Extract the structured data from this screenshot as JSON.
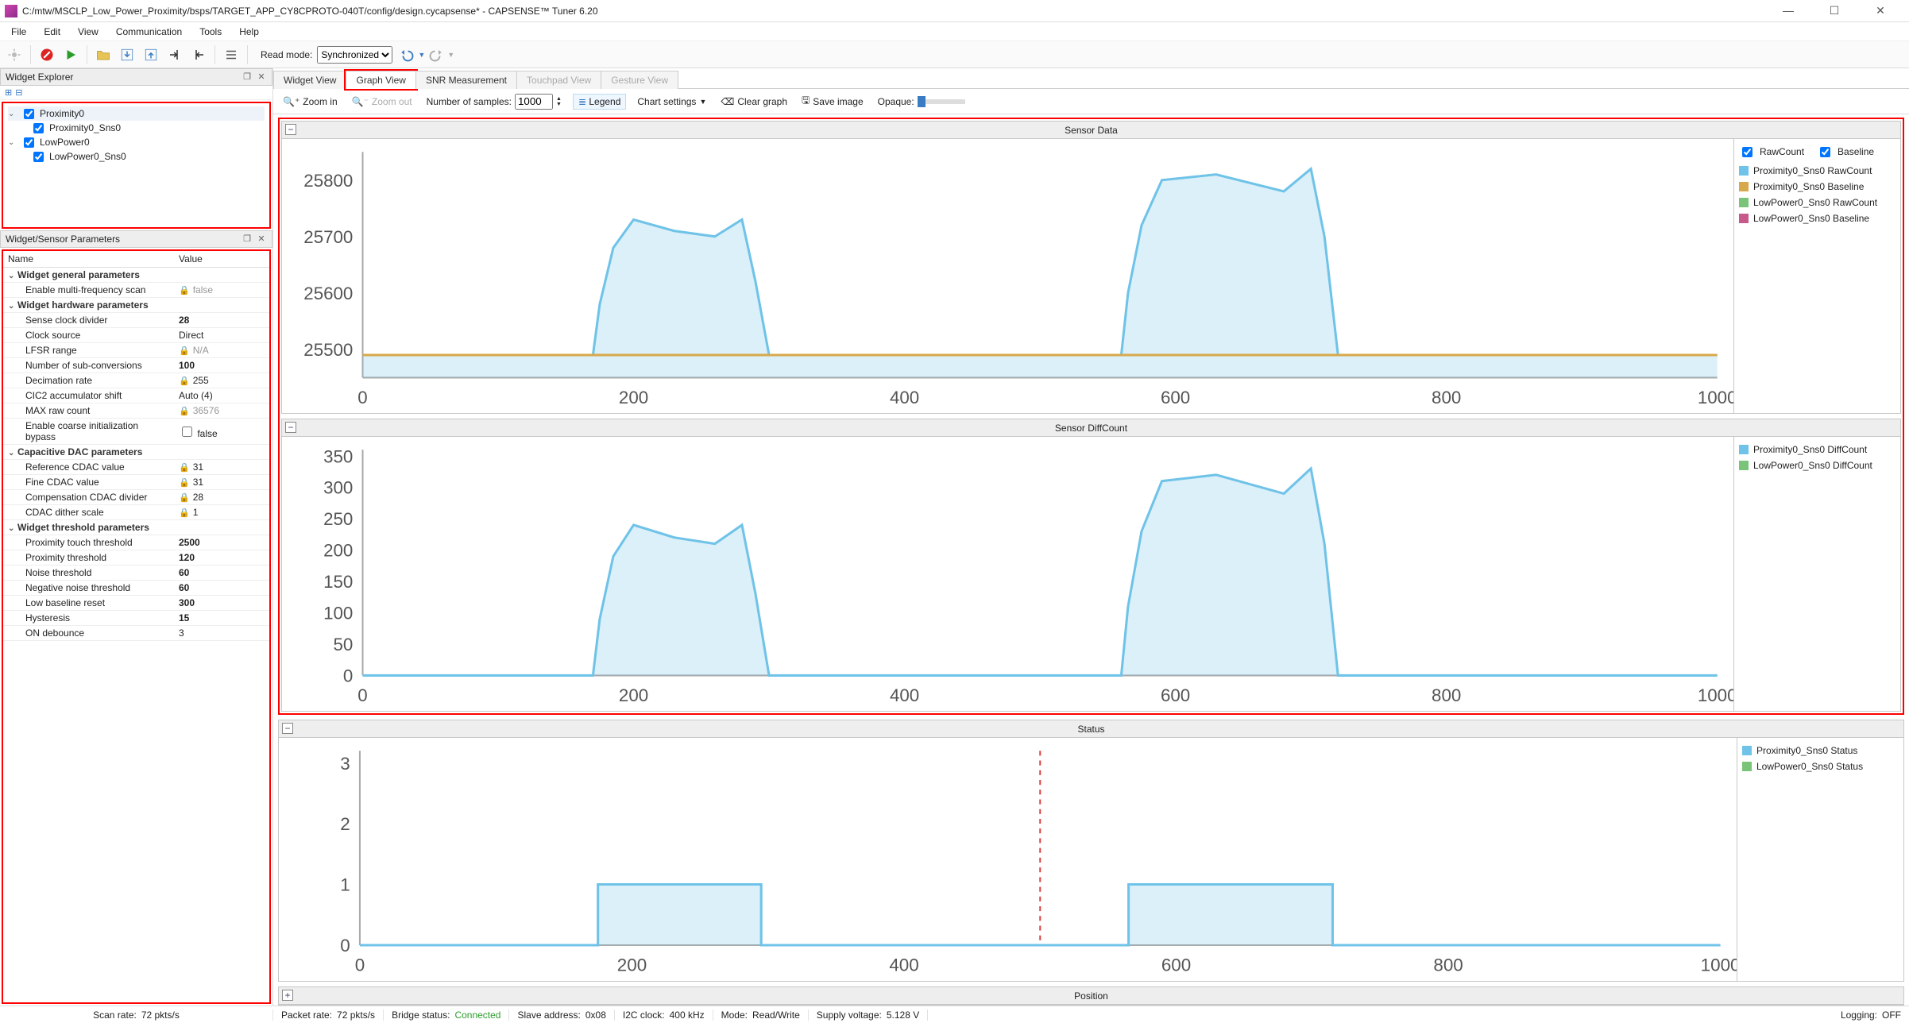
{
  "title": "C:/mtw/MSCLP_Low_Power_Proximity/bsps/TARGET_APP_CY8CPROTO-040T/config/design.cycapsense* - CAPSENSE™ Tuner 6.20",
  "menu": [
    "File",
    "Edit",
    "View",
    "Communication",
    "Tools",
    "Help"
  ],
  "toolbar": {
    "readmode_label": "Read mode:",
    "readmode_value": "Synchronized"
  },
  "explorer": {
    "title": "Widget Explorer",
    "items": [
      {
        "label": "Proximity0",
        "children": [
          {
            "label": "Proximity0_Sns0"
          }
        ]
      },
      {
        "label": "LowPower0",
        "children": [
          {
            "label": "LowPower0_Sns0"
          }
        ]
      }
    ]
  },
  "params": {
    "title": "Widget/Sensor Parameters",
    "columns": [
      "Name",
      "Value"
    ],
    "groups": [
      {
        "name": "Widget general parameters",
        "rows": [
          {
            "n": "Enable multi-frequency scan",
            "v": "false",
            "lock": true,
            "gray": true
          }
        ]
      },
      {
        "name": "Widget hardware parameters",
        "rows": [
          {
            "n": "Sense clock divider",
            "v": "28",
            "bold": true
          },
          {
            "n": "Clock source",
            "v": "Direct"
          },
          {
            "n": "LFSR range",
            "v": "N/A",
            "lock": true,
            "gray": true
          },
          {
            "n": "Number of sub-conversions",
            "v": "100",
            "bold": true
          },
          {
            "n": "Decimation rate",
            "v": "255",
            "lock": true
          },
          {
            "n": "CIC2 accumulator shift",
            "v": "Auto (4)"
          },
          {
            "n": "MAX raw count",
            "v": "36576",
            "lock": true,
            "gray": true
          },
          {
            "n": "Enable coarse initialization bypass",
            "v": "false",
            "checkbox": true
          }
        ]
      },
      {
        "name": "Capacitive DAC parameters",
        "rows": [
          {
            "n": "Reference CDAC value",
            "v": "31",
            "lock": true
          },
          {
            "n": "Fine CDAC value",
            "v": "31",
            "lock": true
          },
          {
            "n": "Compensation CDAC divider",
            "v": "28",
            "lock": true
          },
          {
            "n": "CDAC dither scale",
            "v": "1",
            "lock": true
          }
        ]
      },
      {
        "name": "Widget threshold parameters",
        "rows": [
          {
            "n": "Proximity touch threshold",
            "v": "2500",
            "bold": true
          },
          {
            "n": "Proximity threshold",
            "v": "120",
            "bold": true
          },
          {
            "n": "Noise threshold",
            "v": "60",
            "bold": true
          },
          {
            "n": "Negative noise threshold",
            "v": "60",
            "bold": true
          },
          {
            "n": "Low baseline reset",
            "v": "300",
            "bold": true
          },
          {
            "n": "Hysteresis",
            "v": "15",
            "bold": true
          },
          {
            "n": "ON debounce",
            "v": "3"
          }
        ]
      }
    ]
  },
  "tabs": [
    "Widget View",
    "Graph View",
    "SNR Measurement",
    "Touchpad View",
    "Gesture View"
  ],
  "gtoolbar": {
    "zoom_in": "Zoom in",
    "zoom_out": "Zoom out",
    "num_label": "Number of samples:",
    "num_value": "1000",
    "legend": "Legend",
    "chart_settings": "Chart settings",
    "clear": "Clear graph",
    "save": "Save image",
    "opaque": "Opaque:"
  },
  "charts": {
    "sensor_data": {
      "title": "Sensor Data",
      "legend_top": [
        "RawCount",
        "Baseline"
      ],
      "series": [
        {
          "name": "Proximity0_Sns0 RawCount",
          "color": "#6fc3e8"
        },
        {
          "name": "Proximity0_Sns0 Baseline",
          "color": "#d8a94b"
        },
        {
          "name": "LowPower0_Sns0 RawCount",
          "color": "#7ac47a"
        },
        {
          "name": "LowPower0_Sns0 Baseline",
          "color": "#c75a8a"
        }
      ]
    },
    "diff": {
      "title": "Sensor DiffCount",
      "series": [
        {
          "name": "Proximity0_Sns0 DiffCount",
          "color": "#6fc3e8"
        },
        {
          "name": "LowPower0_Sns0 DiffCount",
          "color": "#7ac47a"
        }
      ]
    },
    "status": {
      "title": "Status",
      "series": [
        {
          "name": "Proximity0_Sns0 Status",
          "color": "#6fc3e8"
        },
        {
          "name": "LowPower0_Sns0 Status",
          "color": "#7ac47a"
        }
      ]
    },
    "position": {
      "title": "Position"
    }
  },
  "chart_data": [
    {
      "type": "line",
      "title": "Sensor Data",
      "xlabel": "",
      "ylabel": "",
      "xlim": [
        0,
        1000
      ],
      "ylim": [
        25450,
        25850
      ],
      "xticks": [
        0,
        200,
        400,
        600,
        800,
        1000
      ],
      "yticks": [
        25500,
        25600,
        25700,
        25800
      ],
      "series": [
        {
          "name": "Proximity0_Sns0 RawCount",
          "x": [
            0,
            170,
            175,
            185,
            200,
            230,
            260,
            280,
            290,
            300,
            560,
            565,
            575,
            590,
            630,
            680,
            700,
            710,
            720,
            1000
          ],
          "y": [
            25490,
            25490,
            25580,
            25680,
            25730,
            25710,
            25700,
            25730,
            25620,
            25490,
            25490,
            25600,
            25720,
            25800,
            25810,
            25780,
            25820,
            25700,
            25490,
            25490
          ]
        },
        {
          "name": "Proximity0_Sns0 Baseline",
          "x": [
            0,
            1000
          ],
          "y": [
            25490,
            25490
          ]
        }
      ]
    },
    {
      "type": "line",
      "title": "Sensor DiffCount",
      "xlabel": "",
      "ylabel": "",
      "xlim": [
        0,
        1000
      ],
      "ylim": [
        0,
        360
      ],
      "xticks": [
        0,
        200,
        400,
        600,
        800,
        1000
      ],
      "yticks": [
        0,
        50,
        100,
        150,
        200,
        250,
        300,
        350
      ],
      "series": [
        {
          "name": "Proximity0_Sns0 DiffCount",
          "x": [
            0,
            170,
            175,
            185,
            200,
            230,
            260,
            280,
            290,
            300,
            560,
            565,
            575,
            590,
            630,
            680,
            700,
            710,
            720,
            1000
          ],
          "y": [
            0,
            0,
            90,
            190,
            240,
            220,
            210,
            240,
            130,
            0,
            0,
            110,
            230,
            310,
            320,
            290,
            330,
            210,
            0,
            0
          ]
        }
      ]
    },
    {
      "type": "line",
      "title": "Status",
      "xlabel": "",
      "ylabel": "",
      "xlim": [
        0,
        1000
      ],
      "ylim": [
        0,
        3.2
      ],
      "xticks": [
        0,
        200,
        400,
        600,
        800,
        1000
      ],
      "yticks": [
        0,
        1,
        2,
        3
      ],
      "series": [
        {
          "name": "Proximity0_Sns0 Status",
          "x": [
            0,
            175,
            175,
            295,
            295,
            565,
            565,
            715,
            715,
            1000
          ],
          "y": [
            0,
            0,
            1,
            1,
            0,
            0,
            1,
            1,
            0,
            0
          ]
        }
      ],
      "annotation": {
        "vline_x": 500,
        "style": "dashed",
        "color": "#d44"
      }
    }
  ],
  "status": {
    "scan_rate_label": "Scan rate:",
    "scan_rate": "72 pkts/s",
    "packet_rate_label": "Packet rate:",
    "packet_rate": "72 pkts/s",
    "bridge_label": "Bridge status:",
    "bridge": "Connected",
    "slave_label": "Slave address:",
    "slave": "0x08",
    "i2c_label": "I2C clock:",
    "i2c": "400 kHz",
    "mode_label": "Mode:",
    "mode": "Read/Write",
    "supply_label": "Supply voltage:",
    "supply": "5.128 V",
    "logging_label": "Logging:",
    "logging": "OFF"
  }
}
